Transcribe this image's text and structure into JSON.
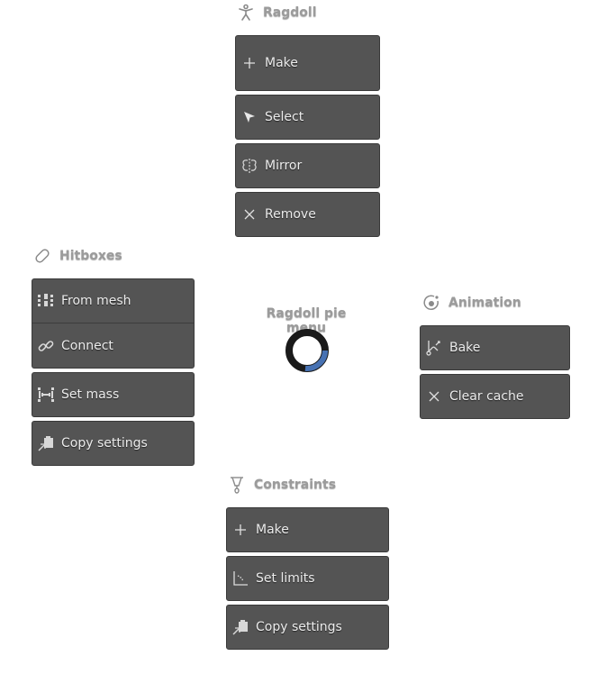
{
  "pie": {
    "title": "Ragdoll pie menu"
  },
  "ragdoll": {
    "header": "Ragdoll",
    "header_icon": "ragdoll-figure-icon",
    "items": [
      {
        "label": "Make",
        "icon": "plus-icon"
      },
      {
        "label": "Select",
        "icon": "cursor-arrow-icon"
      },
      {
        "label": "Mirror",
        "icon": "mirror-icon"
      },
      {
        "label": "Remove",
        "icon": "close-x-icon"
      }
    ]
  },
  "hitboxes": {
    "header": "Hitboxes",
    "header_icon": "capsule-icon",
    "items": [
      {
        "label": "From mesh",
        "icon": "mesh-grid-icon"
      },
      {
        "label": "Connect",
        "icon": "link-icon"
      },
      {
        "label": "Set mass",
        "icon": "mass-bracket-icon"
      },
      {
        "label": "Copy settings",
        "icon": "copy-settings-icon"
      }
    ]
  },
  "animation": {
    "header": "Animation",
    "header_icon": "record-target-icon",
    "items": [
      {
        "label": "Bake",
        "icon": "bake-curve-icon"
      },
      {
        "label": "Clear cache",
        "icon": "close-x-icon"
      }
    ]
  },
  "constraints": {
    "header": "Constraints",
    "header_icon": "constraint-joint-icon",
    "items": [
      {
        "label": "Make",
        "icon": "plus-icon"
      },
      {
        "label": "Set limits",
        "icon": "limits-angle-icon"
      },
      {
        "label": "Copy settings",
        "icon": "copy-settings-icon"
      }
    ]
  },
  "colors": {
    "button_bg": "#545454",
    "ring_dark": "#1a1a1a",
    "ring_accent": "#4772b3",
    "header_text": "#9b9b9b"
  }
}
